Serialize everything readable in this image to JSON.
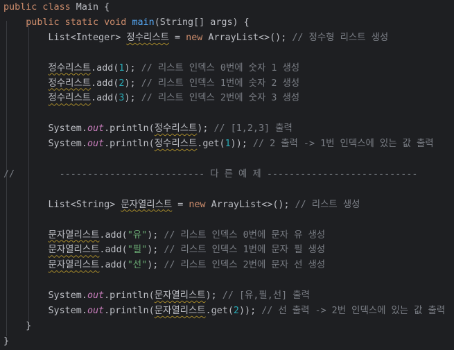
{
  "editor": {
    "colors": {
      "background": "#1e1f22",
      "default_text": "#bcbec4",
      "keyword": "#cf8e6d",
      "method_declaration": "#56a8f5",
      "number": "#2aacb8",
      "string": "#6aab73",
      "comment": "#7a7e85",
      "static_field": "#c77dbb",
      "typo_underline": "#a68a2a"
    },
    "lines": [
      [
        {
          "t": "public class",
          "c": "kw"
        },
        {
          "t": " Main {",
          "c": "pl"
        }
      ],
      [
        {
          "t": "    ",
          "c": "pl"
        },
        {
          "t": "public static void",
          "c": "kw"
        },
        {
          "t": " ",
          "c": "pl"
        },
        {
          "t": "main",
          "c": "fn"
        },
        {
          "t": "(String[] args) {",
          "c": "pl"
        }
      ],
      [
        {
          "t": "        List<Integer> ",
          "c": "pl"
        },
        {
          "t": "정수리스트",
          "c": "pl",
          "typo": true
        },
        {
          "t": " = ",
          "c": "pl"
        },
        {
          "t": "new",
          "c": "kw"
        },
        {
          "t": " ArrayList<>(); ",
          "c": "pl"
        },
        {
          "t": "// 정수형 리스트 생성",
          "c": "cm"
        }
      ],
      [],
      [
        {
          "t": "        ",
          "c": "pl"
        },
        {
          "t": "정수리스트",
          "c": "pl",
          "typo": true
        },
        {
          "t": ".add(",
          "c": "pl"
        },
        {
          "t": "1",
          "c": "num"
        },
        {
          "t": "); ",
          "c": "pl"
        },
        {
          "t": "// 리스트 인덱스 0번에 숫자 1 생성",
          "c": "cm"
        }
      ],
      [
        {
          "t": "        ",
          "c": "pl"
        },
        {
          "t": "정수리스트",
          "c": "pl",
          "typo": true
        },
        {
          "t": ".add(",
          "c": "pl"
        },
        {
          "t": "2",
          "c": "num"
        },
        {
          "t": "); ",
          "c": "pl"
        },
        {
          "t": "// 리스트 인덱스 1번에 숫자 2 생성",
          "c": "cm"
        }
      ],
      [
        {
          "t": "        ",
          "c": "pl"
        },
        {
          "t": "정수리스트",
          "c": "pl",
          "typo": true
        },
        {
          "t": ".add(",
          "c": "pl"
        },
        {
          "t": "3",
          "c": "num"
        },
        {
          "t": "); ",
          "c": "pl"
        },
        {
          "t": "// 리스트 인덱스 2번에 숫자 3 생성",
          "c": "cm"
        }
      ],
      [],
      [
        {
          "t": "        System.",
          "c": "pl"
        },
        {
          "t": "out",
          "c": "fld"
        },
        {
          "t": ".println(",
          "c": "pl"
        },
        {
          "t": "정수리스트",
          "c": "pl",
          "typo": true
        },
        {
          "t": "); ",
          "c": "pl"
        },
        {
          "t": "// [1,2,3] 출력",
          "c": "cm"
        }
      ],
      [
        {
          "t": "        System.",
          "c": "pl"
        },
        {
          "t": "out",
          "c": "fld"
        },
        {
          "t": ".println(",
          "c": "pl"
        },
        {
          "t": "정수리스트",
          "c": "pl",
          "typo": true
        },
        {
          "t": ".get(",
          "c": "pl"
        },
        {
          "t": "1",
          "c": "num"
        },
        {
          "t": ")); ",
          "c": "pl"
        },
        {
          "t": "// 2 출력 -> 1번 인덱스에 있는 값 출력",
          "c": "cm"
        }
      ],
      [],
      [
        {
          "t": "//        -------------------------- 다 른 예 제 ---------------------------",
          "c": "cm"
        }
      ],
      [],
      [
        {
          "t": "        List<String> ",
          "c": "pl"
        },
        {
          "t": "문자열리스트",
          "c": "pl",
          "typo": true
        },
        {
          "t": " = ",
          "c": "pl"
        },
        {
          "t": "new",
          "c": "kw"
        },
        {
          "t": " ArrayList<>(); ",
          "c": "pl"
        },
        {
          "t": "// 리스트 생성",
          "c": "cm"
        }
      ],
      [],
      [
        {
          "t": "        ",
          "c": "pl"
        },
        {
          "t": "문자열리스트",
          "c": "pl",
          "typo": true
        },
        {
          "t": ".add(",
          "c": "pl"
        },
        {
          "t": "\"유\"",
          "c": "str"
        },
        {
          "t": "); ",
          "c": "pl"
        },
        {
          "t": "// 리스트 인덱스 0번에 문자 유 생성",
          "c": "cm"
        }
      ],
      [
        {
          "t": "        ",
          "c": "pl"
        },
        {
          "t": "문자열리스트",
          "c": "pl",
          "typo": true
        },
        {
          "t": ".add(",
          "c": "pl"
        },
        {
          "t": "\"필\"",
          "c": "str"
        },
        {
          "t": "); ",
          "c": "pl"
        },
        {
          "t": "// 리스트 인덱스 1번에 문자 필 생성",
          "c": "cm"
        }
      ],
      [
        {
          "t": "        ",
          "c": "pl"
        },
        {
          "t": "문자열리스트",
          "c": "pl",
          "typo": true
        },
        {
          "t": ".add(",
          "c": "pl"
        },
        {
          "t": "\"선\"",
          "c": "str"
        },
        {
          "t": "); ",
          "c": "pl"
        },
        {
          "t": "// 리스트 인덱스 2번에 문자 선 생성",
          "c": "cm"
        }
      ],
      [],
      [
        {
          "t": "        System.",
          "c": "pl"
        },
        {
          "t": "out",
          "c": "fld"
        },
        {
          "t": ".println(",
          "c": "pl"
        },
        {
          "t": "문자열리스트",
          "c": "pl",
          "typo": true
        },
        {
          "t": "); ",
          "c": "pl"
        },
        {
          "t": "// [유,필,선] 출력",
          "c": "cm"
        }
      ],
      [
        {
          "t": "        System.",
          "c": "pl"
        },
        {
          "t": "out",
          "c": "fld"
        },
        {
          "t": ".println(",
          "c": "pl"
        },
        {
          "t": "문자열리스트",
          "c": "pl",
          "typo": true
        },
        {
          "t": ".get(",
          "c": "pl"
        },
        {
          "t": "2",
          "c": "num"
        },
        {
          "t": ")); ",
          "c": "pl"
        },
        {
          "t": "// 선 출력 -> 2번 인덱스에 있는 값 출력",
          "c": "cm"
        }
      ],
      [
        {
          "t": "    }",
          "c": "pl"
        }
      ],
      [
        {
          "t": "}",
          "c": "pl"
        }
      ]
    ]
  }
}
